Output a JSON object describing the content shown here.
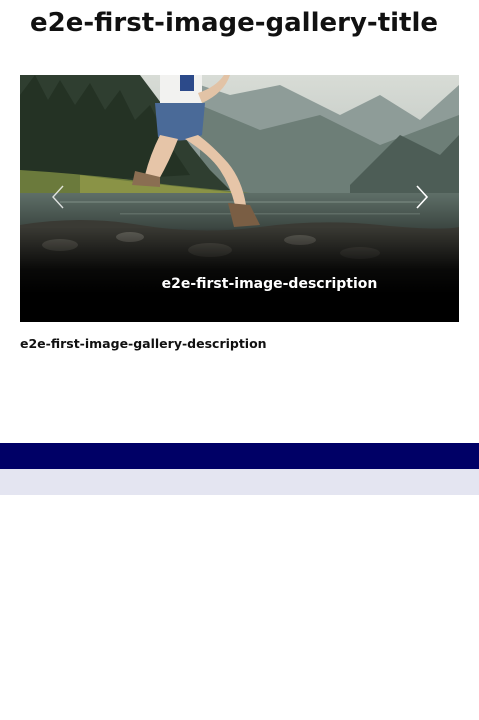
{
  "gallery": {
    "title": "e2e-first-image-gallery-title",
    "description": "e2e-first-image-gallery-description",
    "slides": [
      {
        "description": "e2e-first-image-description",
        "image_alt": "person jumping near a mountain lake"
      }
    ],
    "controls": {
      "prev_icon": "chevron-left-icon",
      "next_icon": "chevron-right-icon"
    }
  },
  "colors": {
    "footer_dark": "#000066",
    "footer_light": "#e4e5f1",
    "caption_text": "#ffffff"
  }
}
